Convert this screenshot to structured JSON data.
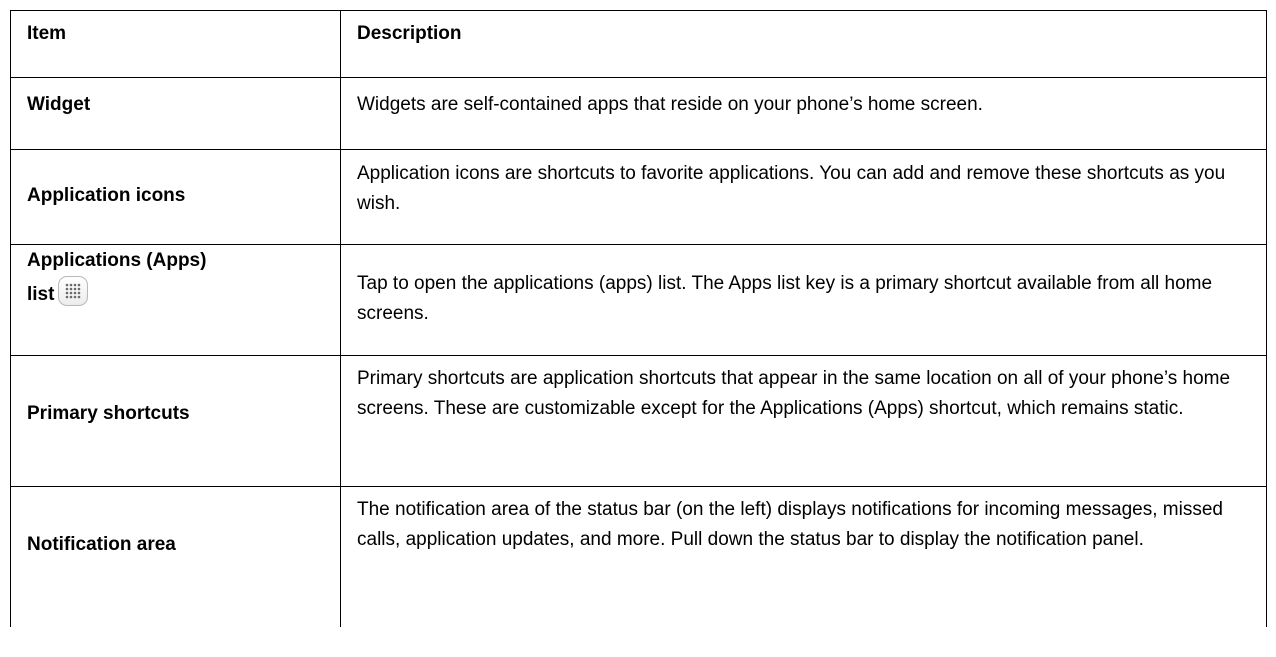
{
  "table": {
    "header": {
      "item": "Item",
      "description": "Description"
    },
    "rows": [
      {
        "item": "Widget",
        "description": "Widgets are self-contained apps that reside on your phone’s home screen."
      },
      {
        "item": "Application icons",
        "description": "Application icons are shortcuts to favorite applications. You can add and remove these shortcuts as you wish."
      },
      {
        "item_line1": "Applications (Apps)",
        "item_line2": "list",
        "icon": "apps-grid-icon",
        "description": "Tap to open the applications (apps) list. The Apps list key is a primary shortcut available from all home screens."
      },
      {
        "item": "Primary shortcuts",
        "description": "Primary shortcuts are application shortcuts that appear in the same location on all of your phone’s home screens. These are customizable except for the Applications (Apps) shortcut, which remains static."
      },
      {
        "item": "Notification area",
        "description": "The notification area of the status bar (on the left) displays notifications for incoming messages, missed calls, application updates, and more. Pull down the status bar to display the notification panel."
      }
    ]
  }
}
